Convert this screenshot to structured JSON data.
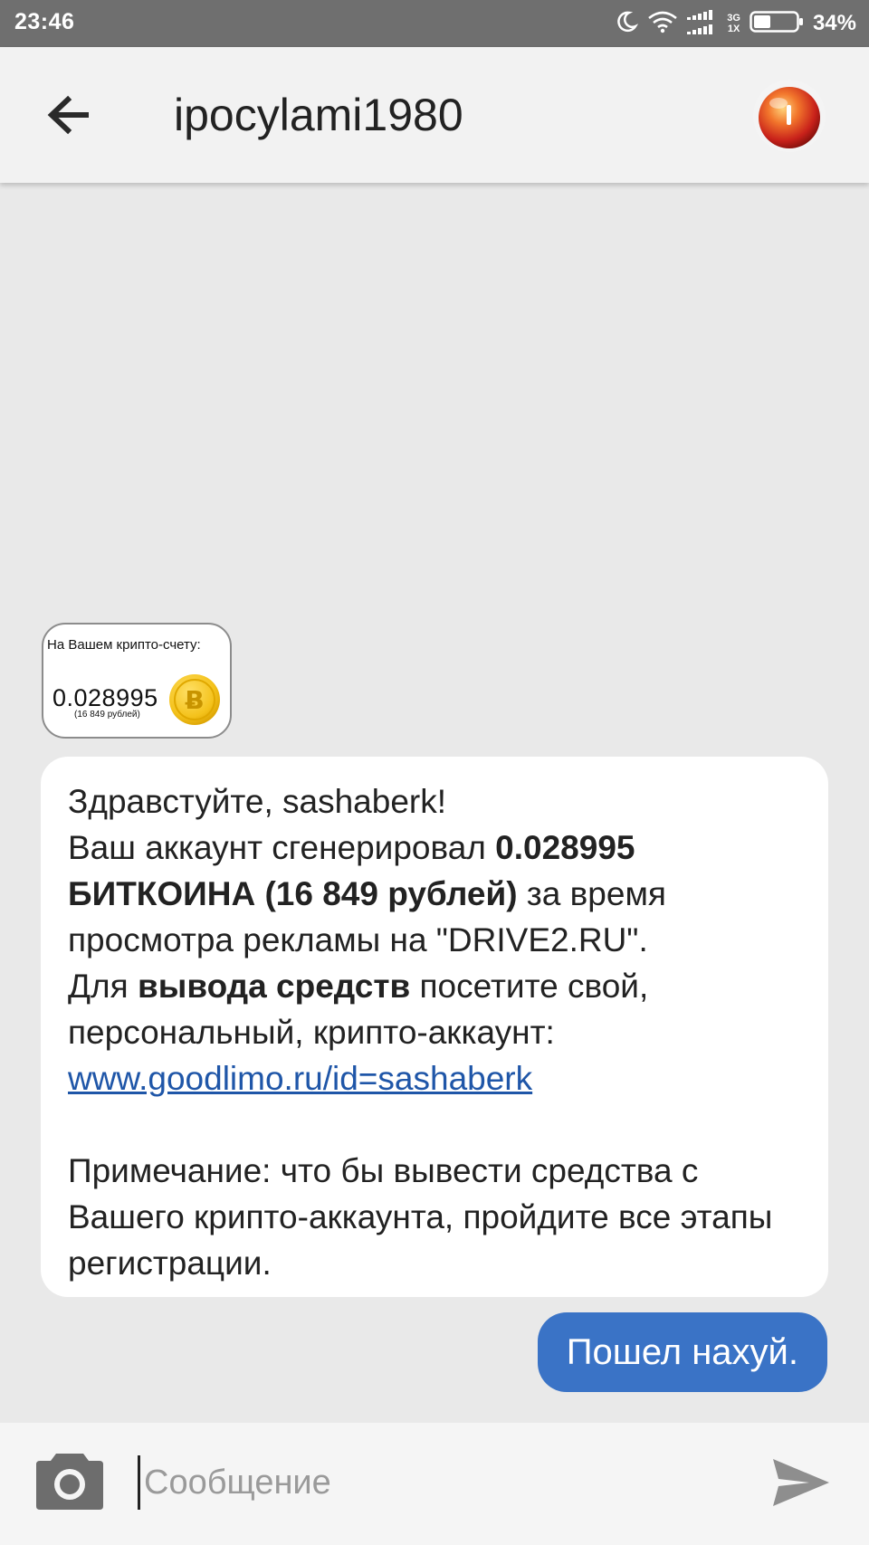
{
  "status_bar": {
    "time": "23:46",
    "network_top": "3G",
    "network_bottom": "1X",
    "battery_percent": "34%",
    "icons": [
      "moon-icon",
      "wifi-icon",
      "signal-icon",
      "signal-icon",
      "battery-icon"
    ]
  },
  "header": {
    "title": "ipocylami1980",
    "back_icon": "arrow-left-icon",
    "avatar_icon": "apple-avatar"
  },
  "messages": {
    "image_card": {
      "caption": "На Вашем крипто-счету:",
      "amount": "0.028995",
      "rubles": "(16 849 рублей)",
      "coin_symbol": "Ƀ"
    },
    "incoming": {
      "greeting": "Здравстуйте,  sashaberk!",
      "line1_pre": "Ваш аккаунт сгенерировал ",
      "line1_bold": "0.028995 БИТКОИНА (16 849 рублей)",
      "line1_post": " за время просмотра рекламы на \"DRIVE2.RU\".",
      "line2_pre": "Для ",
      "line2_bold": "вывода средств",
      "line2_post": " посетите свой, персональный,  крипто-аккаунт:",
      "link": "www.goodlimo.ru/id=sashaberk",
      "note": "Примечание: что бы вывести средства с Вашего крипто-аккаунта,  пройдите все этапы регистрации."
    },
    "outgoing": {
      "text": "Пошел нахуй."
    }
  },
  "composer": {
    "placeholder": "Сообщение",
    "camera_icon": "camera-icon",
    "send_icon": "send-icon"
  },
  "colors": {
    "status_bar": "#6f6f6f",
    "header_bg": "#f2f2f2",
    "chat_bg": "#e9e9e9",
    "outgoing_bubble": "#3a73c6",
    "link": "#1f56a8"
  }
}
